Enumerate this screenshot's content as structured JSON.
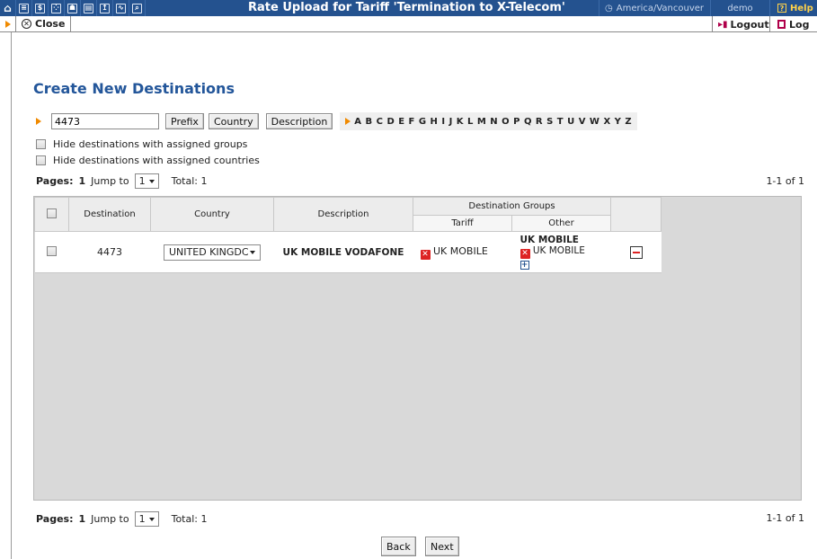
{
  "topbar": {
    "icons": [
      "home-icon",
      "list-icon",
      "dollar-icon",
      "grid-icon",
      "person-icon",
      "rates-icon",
      "upload-icon",
      "chart-icon",
      "search-icon"
    ],
    "title": "Rate Upload for Tariff 'Termination to X-Telecom'",
    "timezone": "America/Vancouver",
    "user": "demo",
    "help": "Help"
  },
  "actionbar": {
    "close": "Close",
    "logout": "Logout",
    "log": "Log"
  },
  "page": {
    "title": "Create New Destinations"
  },
  "filter": {
    "value": "4473",
    "prefix_btn": "Prefix",
    "country_btn": "Country",
    "description_btn": "Description",
    "alphabet": "A B C D E F G H I J K L M N O P Q R S T U V W X Y Z"
  },
  "options": {
    "hide_groups": "Hide destinations with assigned groups",
    "hide_countries": "Hide destinations with assigned countries"
  },
  "pager": {
    "pages_label": "Pages:",
    "page": "1",
    "jump_label": "Jump to",
    "jump_value": "1",
    "total": "Total: 1",
    "range": "1-1 of 1"
  },
  "table": {
    "headers": {
      "destination": "Destination",
      "country": "Country",
      "description": "Description",
      "groups": "Destination Groups",
      "tariff": "Tariff",
      "other": "Other"
    },
    "rows": [
      {
        "destination": "4473",
        "country": "UNITED KINGDC",
        "description": "UK MOBILE VODAFONE",
        "tariff_group": "UK MOBILE",
        "other_title": "UK MOBILE",
        "other_group": "UK MOBILE"
      }
    ]
  },
  "footer": {
    "back": "Back",
    "next": "Next"
  },
  "colors": {
    "toolbar_bg": "#24528f",
    "title_color": "#23569a",
    "accent_orange": "#f08a00",
    "remove_red": "#dd2222"
  }
}
